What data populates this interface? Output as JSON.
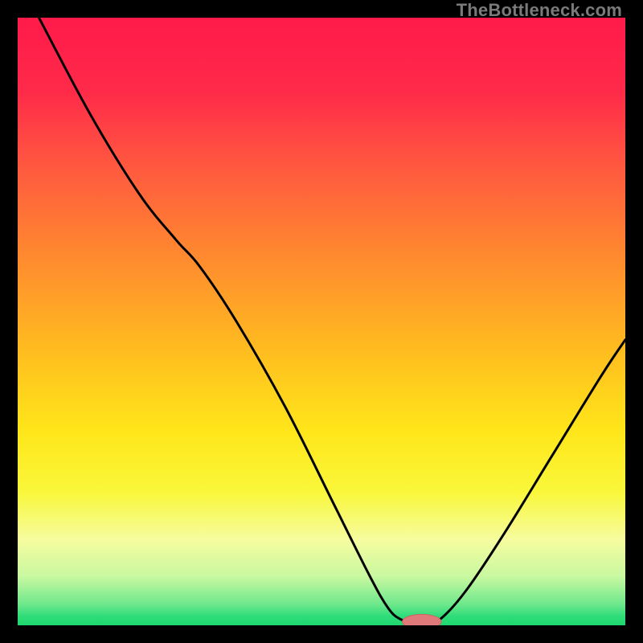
{
  "watermark": "TheBottleneck.com",
  "colors": {
    "gradient_stops": [
      {
        "offset": 0.0,
        "color": "#ff1a4a"
      },
      {
        "offset": 0.12,
        "color": "#ff2a49"
      },
      {
        "offset": 0.25,
        "color": "#ff5a3f"
      },
      {
        "offset": 0.4,
        "color": "#ff8c2e"
      },
      {
        "offset": 0.55,
        "color": "#ffbd1f"
      },
      {
        "offset": 0.68,
        "color": "#ffe61a"
      },
      {
        "offset": 0.78,
        "color": "#f9f73a"
      },
      {
        "offset": 0.86,
        "color": "#f6fca0"
      },
      {
        "offset": 0.92,
        "color": "#c8f8a0"
      },
      {
        "offset": 0.965,
        "color": "#6fe88c"
      },
      {
        "offset": 0.985,
        "color": "#2fdc7a"
      },
      {
        "offset": 1.0,
        "color": "#1fd86f"
      }
    ],
    "curve_stroke": "#000000",
    "marker_fill": "#e07a7a",
    "marker_stroke": "#c96565"
  },
  "chart_data": {
    "type": "line",
    "title": "",
    "xlabel": "",
    "ylabel": "",
    "x_range": [
      0,
      100
    ],
    "y_range": [
      0,
      100
    ],
    "series": [
      {
        "name": "bottleneck-curve",
        "points": [
          {
            "x": 3.5,
            "y": 100
          },
          {
            "x": 12,
            "y": 84
          },
          {
            "x": 20,
            "y": 71
          },
          {
            "x": 26,
            "y": 63.5
          },
          {
            "x": 30,
            "y": 59
          },
          {
            "x": 36,
            "y": 50
          },
          {
            "x": 44,
            "y": 36
          },
          {
            "x": 52,
            "y": 20
          },
          {
            "x": 58,
            "y": 8
          },
          {
            "x": 61,
            "y": 2.8
          },
          {
            "x": 63,
            "y": 1.0
          },
          {
            "x": 65,
            "y": 0.6
          },
          {
            "x": 68,
            "y": 0.6
          },
          {
            "x": 70,
            "y": 1.4
          },
          {
            "x": 74,
            "y": 6
          },
          {
            "x": 80,
            "y": 15
          },
          {
            "x": 88,
            "y": 28
          },
          {
            "x": 96,
            "y": 41
          },
          {
            "x": 100,
            "y": 47
          }
        ]
      }
    ],
    "marker": {
      "x": 66.5,
      "y": 0.6,
      "rx": 3.2,
      "ry": 1.2
    }
  }
}
